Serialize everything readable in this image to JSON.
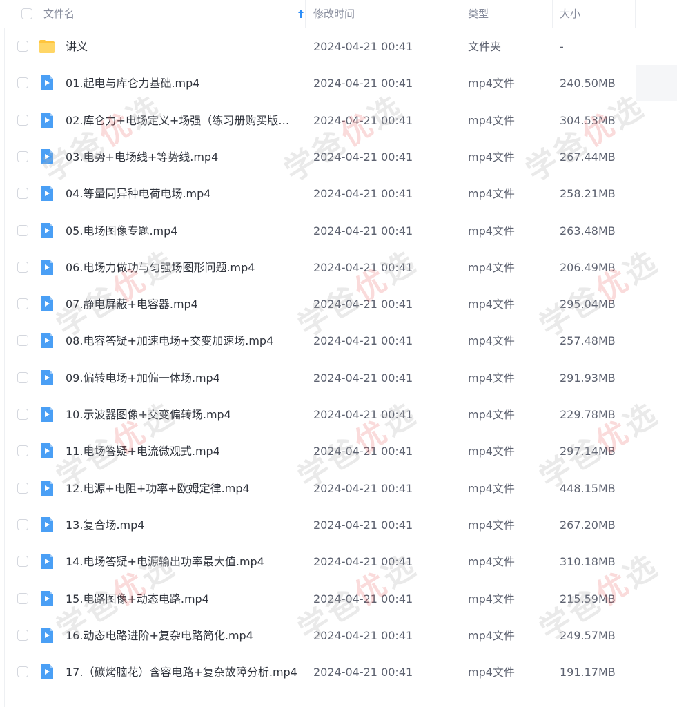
{
  "header": {
    "col_name": "文件名",
    "col_time": "修改时间",
    "col_type": "类型",
    "col_size": "大小"
  },
  "files": [
    {
      "name": "讲义",
      "time": "2024-04-21 00:41",
      "type": "文件夹",
      "size": "-",
      "icon": "folder-icon"
    },
    {
      "name": "01.起电与库仑力基础.mp4",
      "time": "2024-04-21 00:41",
      "type": "mp4文件",
      "size": "240.50MB",
      "icon": "video-file-icon"
    },
    {
      "name": "02.库仑力+电场定义+场强（练习册购买版本...",
      "time": "2024-04-21 00:41",
      "type": "mp4文件",
      "size": "304.53MB",
      "icon": "video-file-icon"
    },
    {
      "name": "03.电势+电场线+等势线.mp4",
      "time": "2024-04-21 00:41",
      "type": "mp4文件",
      "size": "267.44MB",
      "icon": "video-file-icon"
    },
    {
      "name": "04.等量同异种电荷电场.mp4",
      "time": "2024-04-21 00:41",
      "type": "mp4文件",
      "size": "258.21MB",
      "icon": "video-file-icon"
    },
    {
      "name": "05.电场图像专题.mp4",
      "time": "2024-04-21 00:41",
      "type": "mp4文件",
      "size": "263.48MB",
      "icon": "video-file-icon"
    },
    {
      "name": "06.电场力做功与匀强场图形问题.mp4",
      "time": "2024-04-21 00:41",
      "type": "mp4文件",
      "size": "206.49MB",
      "icon": "video-file-icon"
    },
    {
      "name": "07.静电屏蔽+电容器.mp4",
      "time": "2024-04-21 00:41",
      "type": "mp4文件",
      "size": "295.04MB",
      "icon": "video-file-icon"
    },
    {
      "name": "08.电容答疑+加速电场+交变加速场.mp4",
      "time": "2024-04-21 00:41",
      "type": "mp4文件",
      "size": "257.48MB",
      "icon": "video-file-icon"
    },
    {
      "name": "09.偏转电场+加偏一体场.mp4",
      "time": "2024-04-21 00:41",
      "type": "mp4文件",
      "size": "291.93MB",
      "icon": "video-file-icon"
    },
    {
      "name": "10.示波器图像+交变偏转场.mp4",
      "time": "2024-04-21 00:41",
      "type": "mp4文件",
      "size": "229.78MB",
      "icon": "video-file-icon"
    },
    {
      "name": "11.电场答疑+电流微观式.mp4",
      "time": "2024-04-21 00:41",
      "type": "mp4文件",
      "size": "297.14MB",
      "icon": "video-file-icon"
    },
    {
      "name": "12.电源+电阻+功率+欧姆定律.mp4",
      "time": "2024-04-21 00:41",
      "type": "mp4文件",
      "size": "448.15MB",
      "icon": "video-file-icon"
    },
    {
      "name": "13.复合场.mp4",
      "time": "2024-04-21 00:41",
      "type": "mp4文件",
      "size": "267.20MB",
      "icon": "video-file-icon"
    },
    {
      "name": "14.电场答疑+电源输出功率最大值.mp4",
      "time": "2024-04-21 00:41",
      "type": "mp4文件",
      "size": "310.18MB",
      "icon": "video-file-icon"
    },
    {
      "name": "15.电路图像+动态电路.mp4",
      "time": "2024-04-21 00:41",
      "type": "mp4文件",
      "size": "215.59MB",
      "icon": "video-file-icon"
    },
    {
      "name": "16.动态电路进阶+复杂电路简化.mp4",
      "time": "2024-04-21 00:41",
      "type": "mp4文件",
      "size": "249.57MB",
      "icon": "video-file-icon"
    },
    {
      "name": "17.（碳烤脑花）含容电路+复杂故障分析.mp4",
      "time": "2024-04-21 00:41",
      "type": "mp4文件",
      "size": "191.17MB",
      "icon": "video-file-icon"
    }
  ],
  "watermark": {
    "text_a": "学爸",
    "text_b": "优",
    "text_c": "选"
  },
  "colors": {
    "folder": "#ffc53d",
    "video": "#4a9ff5",
    "sort_arrow": "#2e8ef7"
  }
}
